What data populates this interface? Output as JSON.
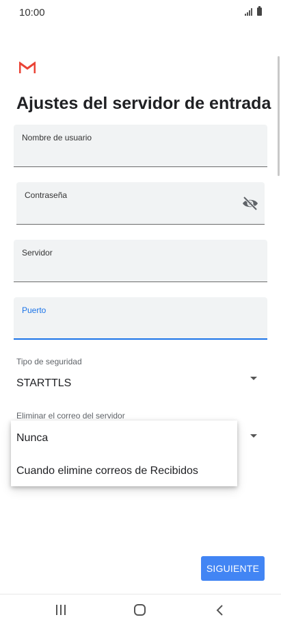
{
  "status_bar": {
    "time": "10:00"
  },
  "page": {
    "title": "Ajustes del servidor de entrada"
  },
  "fields": {
    "username": {
      "label": "Nombre de usuario",
      "value": ""
    },
    "password": {
      "label": "Contraseña",
      "value": ""
    },
    "server": {
      "label": "Servidor",
      "value": ""
    },
    "port": {
      "label": "Puerto",
      "value": ""
    }
  },
  "security": {
    "label": "Tipo de seguridad",
    "value": "STARTTLS"
  },
  "delete_from_server": {
    "label": "Eliminar el correo del servidor",
    "options": [
      "Nunca",
      "Cuando elimine correos de Recibidos"
    ]
  },
  "buttons": {
    "next": "SIGUIENTE"
  },
  "colors": {
    "accent": "#4285f4",
    "focus": "#1a73e8",
    "gmail_red": "#EA4335"
  },
  "icons": [
    "gmail-logo",
    "eye-off-icon",
    "dropdown-arrow-icon",
    "recents-icon",
    "home-icon",
    "back-icon"
  ]
}
